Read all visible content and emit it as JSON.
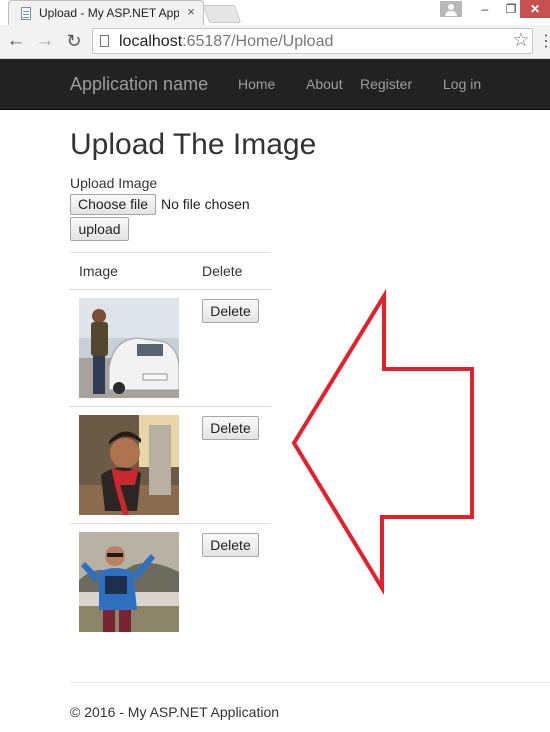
{
  "browser": {
    "tab_title": "Upload - My ASP.NET App",
    "tab_close": "×",
    "url_host": "localhost",
    "url_rest": ":65187/Home/Upload",
    "icons": [
      "page-icon",
      "back-arrow-icon",
      "forward-arrow-icon",
      "reload-icon",
      "star-icon",
      "menu-icon",
      "user-icon",
      "minimize-icon",
      "maximize-icon",
      "close-icon"
    ],
    "nav": {
      "back": "←",
      "forward": "→",
      "reload": "↻",
      "star": "☆",
      "menu": "⋮"
    },
    "window": {
      "minimize": "–",
      "maximize": "❐",
      "close": "✕"
    }
  },
  "site": {
    "brand": "Application name",
    "nav": [
      {
        "label": "Home"
      },
      {
        "label": "About"
      },
      {
        "label": "Register"
      },
      {
        "label": "Log in"
      }
    ],
    "navbar_color": "#222222",
    "nav_text_color": "#9d9d9d"
  },
  "page": {
    "title": "Upload The Image",
    "upload_label": "Upload Image",
    "choose_file": "Choose file",
    "file_status": "No file chosen",
    "upload_button": "upload"
  },
  "table": {
    "headers": [
      "Image",
      "Delete"
    ],
    "rows": [
      {
        "image": "photo-man-with-car",
        "delete_label": "Delete"
      },
      {
        "image": "photo-man-red-scarf",
        "delete_label": "Delete"
      },
      {
        "image": "photo-man-blue-jacket",
        "delete_label": "Delete"
      }
    ]
  },
  "annotation": {
    "shape": "arrow-pointing-left",
    "color": "#e5202a"
  },
  "footer": {
    "text": "© 2016 - My ASP.NET Application"
  }
}
